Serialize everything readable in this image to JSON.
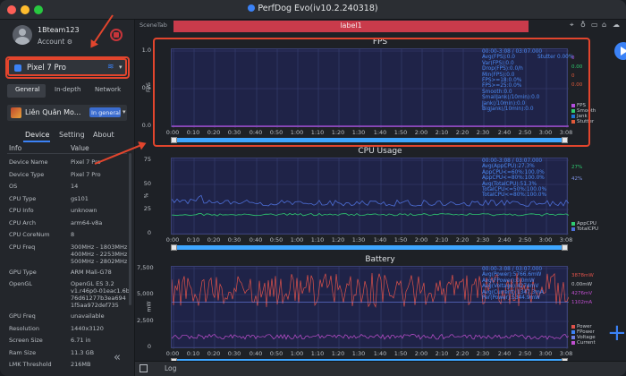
{
  "window": {
    "title": "PerfDog Evo(iv10.2.240318)"
  },
  "sidebar": {
    "username": "1Bteam123",
    "account_label": "Account",
    "device_name": "Pixel 7 Pro",
    "tabs": [
      "General",
      "In-depth",
      "Network"
    ],
    "game_name": "Liên Quân Mo...",
    "game_mode": "In general ...",
    "info_tabs": [
      "Device",
      "Setting",
      "About"
    ],
    "info_header": {
      "col1": "Info",
      "col2": "Value"
    },
    "info_rows": [
      {
        "k": "Device Name",
        "v": "Pixel 7 Pro"
      },
      {
        "k": "Device Type",
        "v": "Pixel 7 Pro"
      },
      {
        "k": "OS",
        "v": "14"
      },
      {
        "k": "CPU Type",
        "v": "gs101"
      },
      {
        "k": "CPU Info",
        "v": "unknown"
      },
      {
        "k": "CPU Arch",
        "v": "arm64-v8a"
      },
      {
        "k": "CPU CoreNum",
        "v": "8"
      },
      {
        "k": "CPU Freq",
        "v": "300MHz - 1803MHz\n400MHz - 2253MHz\n500MHz - 2802MHz"
      },
      {
        "k": "GPU Type",
        "v": "ARM Mali-G78"
      },
      {
        "k": "OpenGL",
        "v": "OpenGL ES 3.2\nv1.r46p0-01eac1.6b\n76d61277b3ea694\n1f5aa972def735"
      },
      {
        "k": "GPU Freq",
        "v": "unavailable"
      },
      {
        "k": "Resolution",
        "v": "1440x3120"
      },
      {
        "k": "Screen Size",
        "v": "6.71 in"
      },
      {
        "k": "Ram Size",
        "v": "11.3 GB"
      },
      {
        "k": "LMK Threshold",
        "v": "216MB"
      }
    ]
  },
  "main": {
    "scene_tab": "SceneTab",
    "label": "label1",
    "log_label": "Log"
  },
  "colors": {
    "accent": "#3b82f6",
    "highlight": "#e2452d",
    "label_bar": "#c93b4b",
    "plot_bg": "#1f2348"
  },
  "charts": {
    "fps": {
      "title": "FPS",
      "ylabel": "FPS",
      "yticks": [
        "1.0",
        "0.5",
        "0.0"
      ],
      "stats": "00:00-3:08 / 03:07.000\nAvg(FPS):0.0\nVar(FPS):0.0\nDrop(FPS):0.0/h\nMin(FPS):0.0\nFPS>=18:0.0%\nFPS>=25:0.0%\nSmooth:0.0\nSmallJank(/10min):0.0\nJank(/10min):0.0\nBigJank(/10min):0.0",
      "stutter": "Stutter 0.00%",
      "right_values": [
        "0",
        "0.00",
        "0",
        "0.00"
      ],
      "legend": [
        "FPS",
        "Smooth",
        "Jank",
        "Stutter"
      ]
    },
    "cpu": {
      "title": "CPU Usage",
      "ylabel": "%",
      "yticks": [
        "75",
        "50",
        "25",
        "0"
      ],
      "stats": "00:00-3:08 / 03:07.000\nAvg(AppCPU):27.3%\nAppCPU<=60%:100.0%\nAppCPU<=80%:100.0%\nAvg(TotalCPU):51.3%\nTotalCPU<=50%:100.0%\nTotalCPU<=80%:100.0%",
      "right_values": [
        "27%",
        "42%"
      ],
      "legend": [
        "AppCPU",
        "TotalCPU"
      ]
    },
    "battery": {
      "title": "Battery",
      "ylabel": "mW",
      "yticks": [
        "7,500",
        "5,000",
        "2,500",
        "0"
      ],
      "stats": "00:00-3:08 / 03:07.000\nAvg(Power):5766.6mW\nAvg(FPower):0.0mW\nAvg(Voltage):4274mV\nAvg(Current):1347.3mA\nPer(Power):5344.9mW",
      "right_values": [
        "3878mW",
        "0.00mW",
        "4276mV",
        "1102mA"
      ],
      "legend": [
        "Power",
        "FPower",
        "Voltage",
        "Current"
      ]
    },
    "xticks": [
      "0:00",
      "0:10",
      "0:20",
      "0:30",
      "0:40",
      "0:50",
      "1:00",
      "1:10",
      "1:20",
      "1:30",
      "1:40",
      "1:50",
      "2:00",
      "2:10",
      "2:20",
      "2:30",
      "2:40",
      "2:50",
      "3:00",
      "3:08"
    ]
  }
}
